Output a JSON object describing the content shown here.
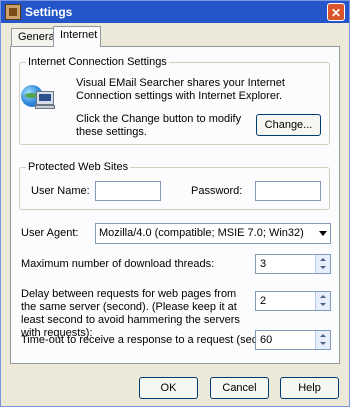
{
  "window": {
    "title": "Settings",
    "close_glyph": "✕"
  },
  "tabs": [
    {
      "label": "General",
      "active": false
    },
    {
      "label": "Internet",
      "active": true
    }
  ],
  "internet_connection": {
    "group_title": "Internet Connection Settings",
    "description": "Visual EMail Searcher shares your Internet Connection settings with Internet Explorer.",
    "change_hint": "Click the Change button to modify these settings.",
    "change_button": "Change...",
    "icon": "globe-computer-icon"
  },
  "protected_sites": {
    "group_title": "Protected Web Sites",
    "username_label": "User Name:",
    "username_value": "",
    "password_label": "Password:",
    "password_value": ""
  },
  "user_agent": {
    "label": "User Agent:",
    "value": "Mozilla/4.0 (compatible; MSIE 7.0; Win32)"
  },
  "threads": {
    "label": "Maximum number of download threads:",
    "value": "3"
  },
  "delay": {
    "label": "Delay between requests for web pages from the same server (second). (Please keep it at least second to avoid hammering the servers with requests):",
    "value": "2"
  },
  "timeout": {
    "label": "Time-out to receive a response to a request (second):",
    "value": "60"
  },
  "buttons": {
    "ok": "OK",
    "cancel": "Cancel",
    "help": "Help"
  },
  "colors": {
    "title_bar": "#2456c9",
    "window_bg": "#ece9d8",
    "panel_bg": "#fcfcfe"
  }
}
